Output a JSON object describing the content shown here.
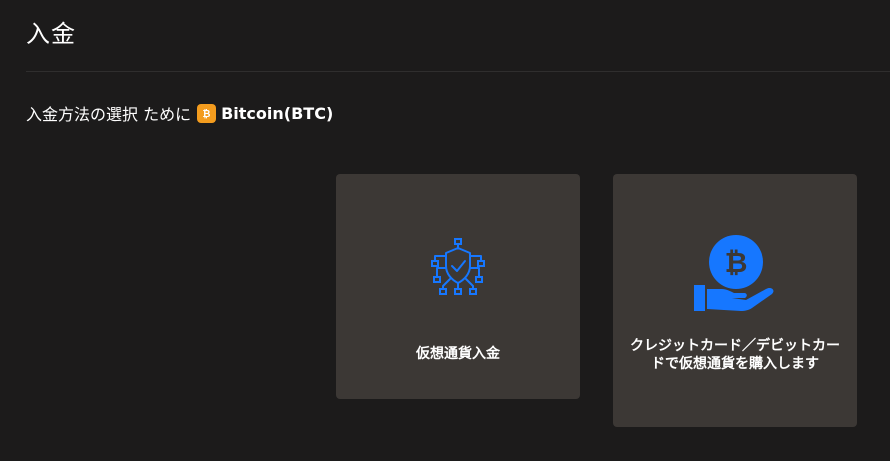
{
  "page": {
    "title": "入金"
  },
  "selection": {
    "prefix": "入金方法の選択 ために",
    "coin_label": "Bitcoin(BTC)",
    "coin_icon": "bitcoin-icon",
    "coin_color": "#f39c1e"
  },
  "methods": [
    {
      "label": "仮想通貨入金",
      "icon": "shield-network-icon"
    },
    {
      "label": "クレジットカード／デビットカードで仮想通貨を購入します",
      "icon": "hand-bitcoin-icon"
    }
  ],
  "colors": {
    "background": "#1c1b1b",
    "card": "#3c3835",
    "accent": "#1677ff"
  }
}
